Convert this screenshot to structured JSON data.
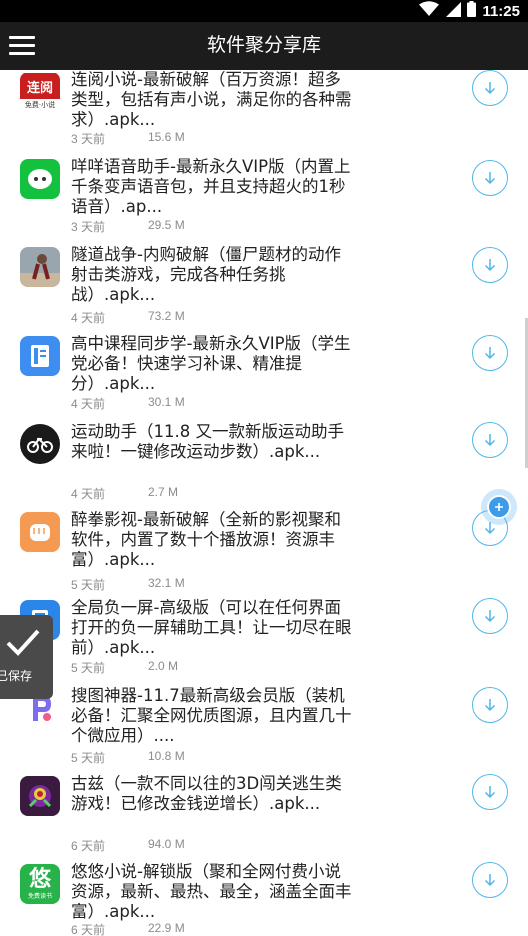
{
  "status_bar": {
    "time": "11:25"
  },
  "app_bar": {
    "title": "软件聚分享库"
  },
  "items": [
    {
      "name": "连阅小说-最新破解（百万资源！超多类型，包括有声小说，满足你的各种需求）.apk...",
      "date": "3 天前",
      "size": "15.6 M",
      "icon": "lianyue-app-icon",
      "color": "#c81e1e",
      "icon_text": "连阅"
    },
    {
      "name": "咩咩语音助手-最新永久VIP版（内置上千条变声语音包，并且支持超火的1秒语音）.ap...",
      "date": "3 天前",
      "size": "29.5 M",
      "icon": "sheep-app-icon",
      "color": "#13c13f"
    },
    {
      "name": "隧道战争-内购破解（僵尸题材的动作射击类游戏，完成各种任务挑战）.apk...",
      "date": "4 天前",
      "size": "73.2 M",
      "icon": "game-character-icon",
      "color": "#9aa6ae"
    },
    {
      "name": "高中课程同步学-最新永久VIP版（学生党必备！快速学习补课、精准提分）.apk...",
      "date": "4 天前",
      "size": "30.1 M",
      "icon": "book-app-icon",
      "color": "#3d8ef0"
    },
    {
      "name": "运动助手（11.8 又一款新版运动助手来啦！一键修改运动步数）.apk...",
      "date": "4 天前",
      "size": "2.7 M",
      "icon": "bicycle-app-icon",
      "color": "#1a1a1a"
    },
    {
      "name": "醉拳影视-最新破解（全新的影视聚和软件，内置了数十个播放源！资源丰富）.apk...",
      "date": "5 天前",
      "size": "32.1 M",
      "icon": "fist-app-icon",
      "color": "#f49a52"
    },
    {
      "name": "全局负一屏-高级版（可以在任何界面打开的负一屏辅助工具！让一切尽在眼前）.apk...",
      "date": "5 天前",
      "size": "2.0 M",
      "icon": "screen-app-icon",
      "color": "#2a86e8"
    },
    {
      "name": "搜图神器-11.7最新高级会员版（装机必备！汇聚全网优质图源，且内置几十个微应用）....",
      "date": "5 天前",
      "size": "10.8 M",
      "icon": "picture-search-app-icon",
      "color": "#ffffff"
    },
    {
      "name": "古兹（一款不同以往的3D闯关逃生类游戏！已修改金钱逆增长）.apk...",
      "date": "6 天前",
      "size": "94.0 M",
      "icon": "monster-app-icon",
      "color": "#3a1a3e"
    },
    {
      "name": "悠悠小说-解锁版（聚和全网付费小说资源，最新、最热、最全，涵盖全面丰富）.apk...",
      "date": "6 天前",
      "size": "22.9 M",
      "icon": "youyou-app-icon",
      "color": "#27b24a",
      "icon_text": "悠",
      "icon_subtext": "免费读书"
    }
  ],
  "toast": {
    "label": "已保存"
  }
}
